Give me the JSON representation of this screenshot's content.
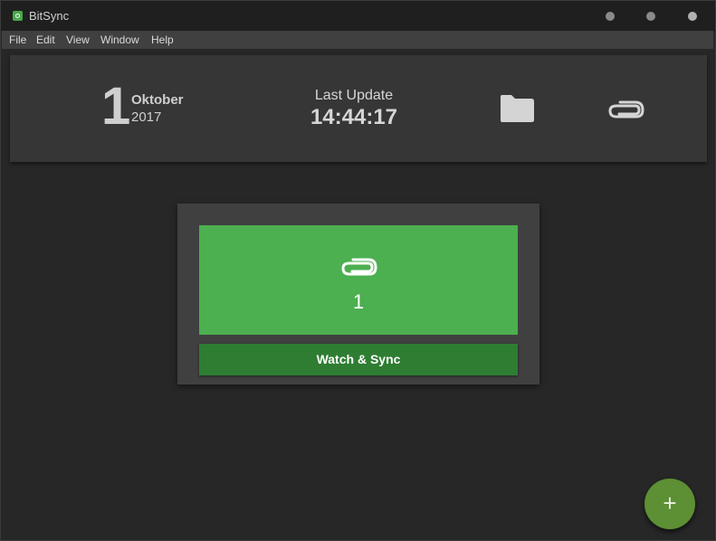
{
  "window": {
    "title": "BitSync"
  },
  "menu": {
    "items": [
      "File",
      "Edit",
      "View",
      "Window",
      "Help"
    ]
  },
  "header": {
    "day": "1",
    "month": "Oktober",
    "year": "2017",
    "last_update_label": "Last Update",
    "last_update_time": "14:44:17",
    "folder_icon": "folder-icon",
    "attachment_icon": "paperclip-icon"
  },
  "sync_card": {
    "icon": "paperclip-icon",
    "count": "1",
    "button_label": "Watch & Sync",
    "tile_color": "#4caf50",
    "button_color": "#2e7d32"
  },
  "fab": {
    "label": "+",
    "color": "#5d8f34"
  }
}
